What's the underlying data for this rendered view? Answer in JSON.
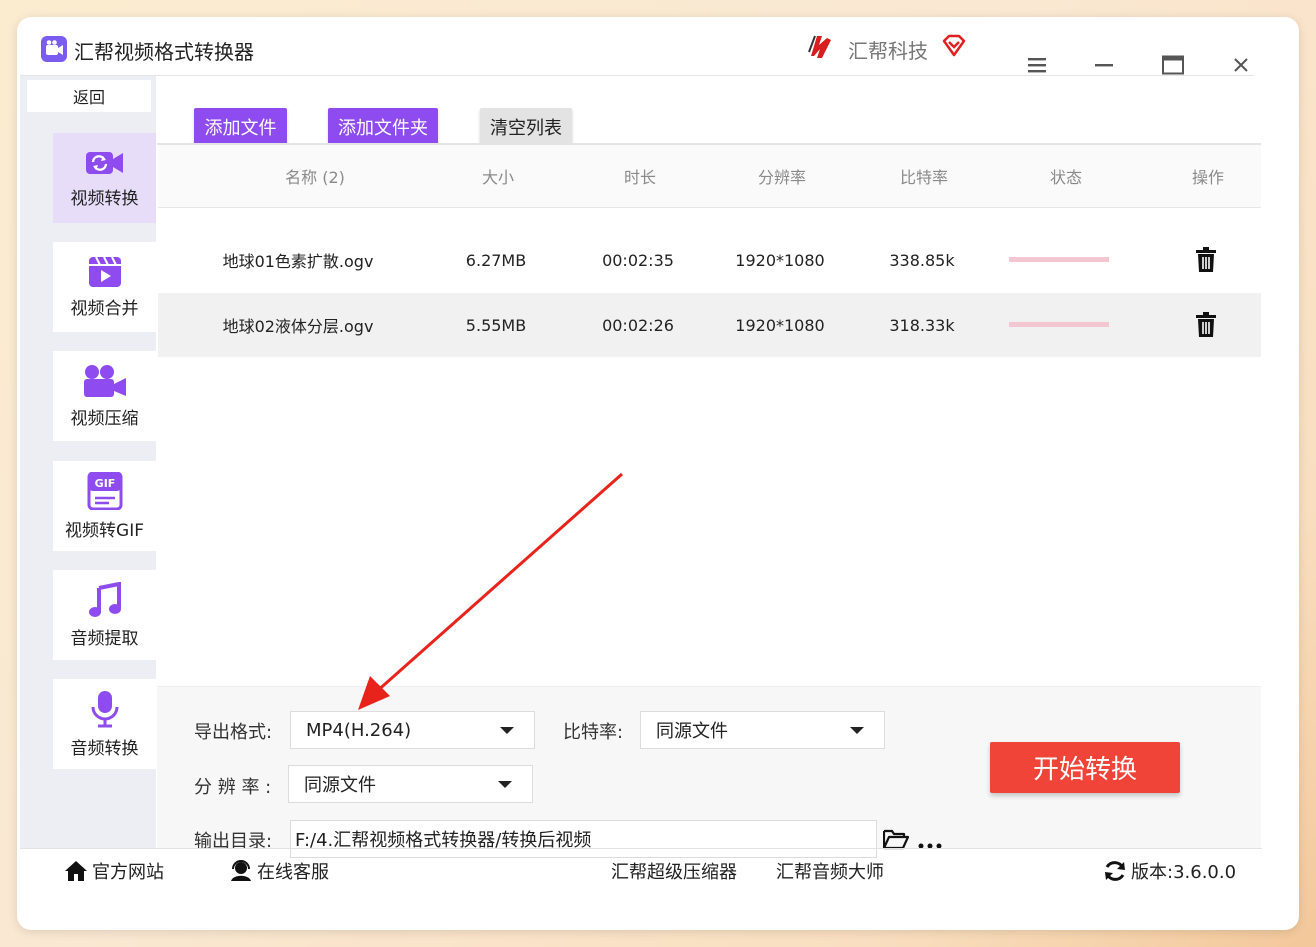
{
  "window": {
    "title": "汇帮视频格式转换器"
  },
  "brand": {
    "name": "汇帮科技"
  },
  "sidebar": {
    "back_label": "返回",
    "items": [
      {
        "label": "视频转换",
        "icon": "video-convert-icon",
        "active": true
      },
      {
        "label": "视频合并",
        "icon": "video-merge-icon",
        "active": false
      },
      {
        "label": "视频压缩",
        "icon": "video-compress-icon",
        "active": false
      },
      {
        "label": "视频转GIF",
        "icon": "gif-icon",
        "active": false
      },
      {
        "label": "音频提取",
        "icon": "music-note-icon",
        "active": false
      },
      {
        "label": "音频转换",
        "icon": "microphone-icon",
        "active": false
      }
    ]
  },
  "toolbar": {
    "add_file": "添加文件",
    "add_folder": "添加文件夹",
    "clear_list": "清空列表"
  },
  "table": {
    "headers": [
      "名称 (2)",
      "大小",
      "时长",
      "分辨率",
      "比特率",
      "状态",
      "操作"
    ],
    "rows": [
      {
        "name": "地球01色素扩散.ogv",
        "size": "6.27MB",
        "duration": "00:02:35",
        "resolution": "1920*1080",
        "bitrate": "338.85k",
        "progress": 0
      },
      {
        "name": "地球02液体分层.ogv",
        "size": "5.55MB",
        "duration": "00:02:26",
        "resolution": "1920*1080",
        "bitrate": "318.33k",
        "progress": 0
      }
    ]
  },
  "settings": {
    "format_label": "导出格式:",
    "format_value": "MP4(H.264)",
    "bitrate_label": "比特率:",
    "bitrate_value": "同源文件",
    "resolution_label": "分 辨 率 :",
    "resolution_value": "同源文件",
    "output_label": "输出目录:",
    "output_value": "F:/4.汇帮视频格式转换器/转换后视频",
    "start_button": "开始转换"
  },
  "footer": {
    "website": "官方网站",
    "support": "在线客服",
    "link1": "汇帮超级压缩器",
    "link2": "汇帮音频大师",
    "version": "版本:3.6.0.0"
  },
  "colors": {
    "accent": "#8e4cf0",
    "start_button": "#f14438",
    "active_sidebar": "#e7ddf9",
    "progress": "#f4c6d2",
    "annotation_arrow": "#e8231c"
  }
}
